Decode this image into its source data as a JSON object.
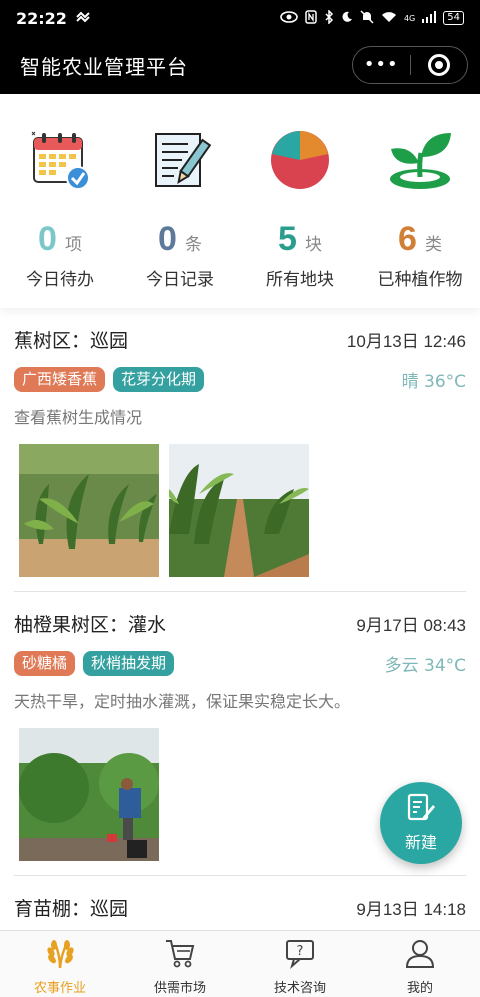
{
  "status_bar": {
    "time": "22:22",
    "network": "4G",
    "battery": "54"
  },
  "header": {
    "title": "智能农业管理平台",
    "more_glyph": "•••"
  },
  "stats": [
    {
      "icon": "calendar-check-icon",
      "count": "0",
      "unit": "项",
      "label": "今日待办",
      "color": "#7cc7c9"
    },
    {
      "icon": "notes-pencil-icon",
      "count": "0",
      "unit": "条",
      "label": "今日记录",
      "color": "#5d7a9a"
    },
    {
      "icon": "pie-chart-icon",
      "count": "5",
      "unit": "块",
      "label": "所有地块",
      "color": "#2a9d8f"
    },
    {
      "icon": "sprout-icon",
      "count": "6",
      "unit": "类",
      "label": "已种植作物",
      "color": "#d17f36"
    }
  ],
  "records": [
    {
      "title": "蕉树区：巡园",
      "time": "10月13日 12:46",
      "crop": "广西矮香蕉",
      "stage": "花芽分化期",
      "weather": "晴 36°C",
      "desc": "查看蕉树生成情况"
    },
    {
      "title": "柚橙果树区：灌水",
      "time": "9月17日 08:43",
      "crop": "砂糖橘",
      "stage": "秋梢抽发期",
      "weather": "多云 34°C",
      "desc": "天热干旱，定时抽水灌溉，保证果实稳定长大。"
    },
    {
      "title": "育苗棚：巡园",
      "time": "9月13日 14:18",
      "crop": "",
      "stage": "",
      "weather": "",
      "desc": ""
    }
  ],
  "fab": {
    "label": "新建",
    "icon": "edit-note-icon"
  },
  "tabs": [
    {
      "label": "农事作业",
      "icon": "wheat-icon",
      "active": true
    },
    {
      "label": "供需市场",
      "icon": "cart-icon",
      "active": false
    },
    {
      "label": "技术咨询",
      "icon": "question-chat-icon",
      "active": false
    },
    {
      "label": "我的",
      "icon": "user-icon",
      "active": false
    }
  ],
  "colors": {
    "accent_teal": "#2aa7a2",
    "tag_orange": "#e07a56",
    "tab_active": "#e8a020"
  }
}
